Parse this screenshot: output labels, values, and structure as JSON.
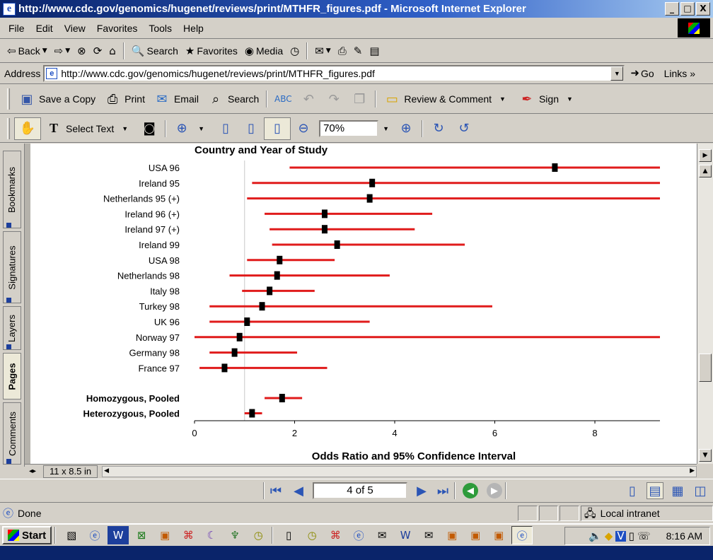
{
  "window": {
    "title": "http://www.cdc.gov/genomics/hugenet/reviews/print/MTHFR_figures.pdf - Microsoft Internet Explorer",
    "minimize": "_",
    "maximize": "□",
    "close": "X"
  },
  "menu": [
    "File",
    "Edit",
    "View",
    "Favorites",
    "Tools",
    "Help"
  ],
  "ie_toolbar": {
    "back": "Back",
    "search": "Search",
    "favorites": "Favorites",
    "media": "Media"
  },
  "address": {
    "label": "Address",
    "url": "http://www.cdc.gov/genomics/hugenet/reviews/print/MTHFR_figures.pdf",
    "go": "Go",
    "links": "Links"
  },
  "acrobat_toolbar": {
    "save_copy": "Save a Copy",
    "print": "Print",
    "email": "Email",
    "search": "Search",
    "review_comment": "Review & Comment",
    "sign": "Sign",
    "select_text": "Select Text",
    "zoom": "70%"
  },
  "nav_tabs": [
    "Bookmarks",
    "Signatures",
    "Layers",
    "Pages",
    "Comments"
  ],
  "page_size": "11 x 8.5 in",
  "page_nav": {
    "page": "4 of 5"
  },
  "status": {
    "text": "Done",
    "zone": "Local intranet"
  },
  "taskbar": {
    "start": "Start",
    "clock": "8:16 AM"
  },
  "chart_data": {
    "type": "forest",
    "header": "Country and Year of Study",
    "xlabel": "Odds Ratio and 95% Confidence Interval",
    "xlim": [
      0,
      9.3
    ],
    "xticks": [
      0,
      2,
      4,
      6,
      8
    ],
    "reference_line": 1,
    "colors": {
      "ci": "#e01b1b",
      "point": "#000000"
    },
    "studies": [
      {
        "label": "USA 96",
        "or": 7.2,
        "lo": 1.9,
        "hi": 9.3
      },
      {
        "label": "Ireland 95",
        "or": 3.55,
        "lo": 1.15,
        "hi": 9.3
      },
      {
        "label": "Netherlands 95 (+)",
        "or": 3.5,
        "lo": 1.05,
        "hi": 9.3
      },
      {
        "label": "Ireland 96 (+)",
        "or": 2.6,
        "lo": 1.4,
        "hi": 4.75
      },
      {
        "label": "Ireland 97 (+)",
        "or": 2.6,
        "lo": 1.5,
        "hi": 4.4
      },
      {
        "label": "Ireland 99",
        "or": 2.85,
        "lo": 1.55,
        "hi": 5.4
      },
      {
        "label": "USA 98",
        "or": 1.7,
        "lo": 1.05,
        "hi": 2.8
      },
      {
        "label": "Netherlands 98",
        "or": 1.65,
        "lo": 0.7,
        "hi": 3.9
      },
      {
        "label": "Italy 98",
        "or": 1.5,
        "lo": 0.95,
        "hi": 2.4
      },
      {
        "label": "Turkey 98",
        "or": 1.35,
        "lo": 0.3,
        "hi": 5.95
      },
      {
        "label": "UK 96",
        "or": 1.05,
        "lo": 0.3,
        "hi": 3.5
      },
      {
        "label": "Norway 97",
        "or": 0.9,
        "lo": 0.0,
        "hi": 9.3
      },
      {
        "label": "Germany 98",
        "or": 0.8,
        "lo": 0.3,
        "hi": 2.05
      },
      {
        "label": "France 97",
        "or": 0.6,
        "lo": 0.1,
        "hi": 2.65
      }
    ],
    "pooled": [
      {
        "label": "Homozygous, Pooled",
        "or": 1.75,
        "lo": 1.4,
        "hi": 2.15
      },
      {
        "label": "Heterozygous, Pooled",
        "or": 1.15,
        "lo": 1.0,
        "hi": 1.35
      }
    ]
  }
}
